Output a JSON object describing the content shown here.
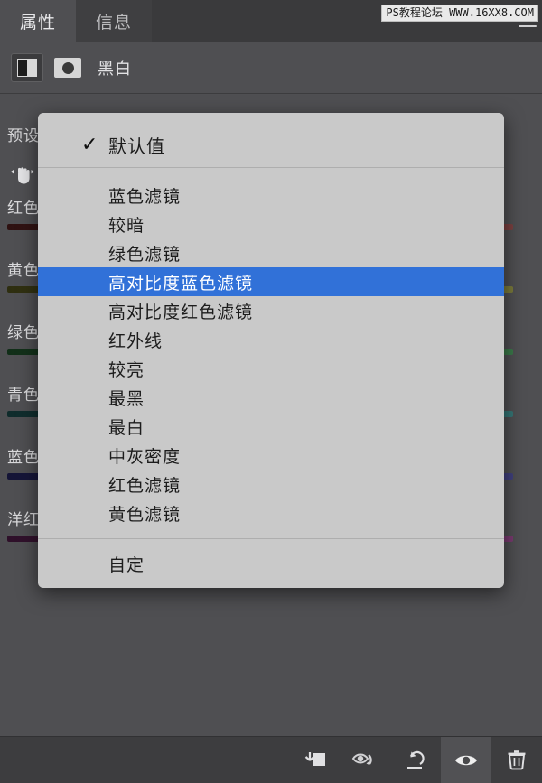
{
  "window": {
    "watermark": "PS教程论坛 WWW.16XX8.COM",
    "panel_menu_icon": "hamburger-menu-icon"
  },
  "tabs": [
    {
      "label": "属性",
      "active": true
    },
    {
      "label": "信息",
      "active": false
    }
  ],
  "adjustment": {
    "layer_icon": "black-and-white-adjustment-icon",
    "mask_icon": "layer-mask-thumbnail-icon",
    "title": "黑白"
  },
  "preset": {
    "label": "预设",
    "scrub_icon": "scrubby-hand-icon"
  },
  "channels": [
    {
      "label": "红色",
      "track_from": "#3b1a1a",
      "track_to": "#6d3b3b",
      "value_pos": 18
    },
    {
      "label": "黄色",
      "track_from": "#3a3a16",
      "track_to": "#6d6d33",
      "value_pos": 18
    },
    {
      "label": "绿色",
      "track_from": "#183a20",
      "track_to": "#356d41",
      "value_pos": 18
    },
    {
      "label": "青色",
      "track_from": "#163636",
      "track_to": "#2f6a6a",
      "value_pos": 18
    },
    {
      "label": "蓝色",
      "track_from": "#1c1c40",
      "track_to": "#3a3a72",
      "value_pos": 18
    },
    {
      "label": "洋红",
      "track_from": "#3a1736",
      "track_to": "#6d336a",
      "value_pos": 18
    }
  ],
  "dropdown": {
    "accent_color": "#3171d8",
    "background_color": "#c9c9c9",
    "header": {
      "label": "默认值",
      "checked": true,
      "check_glyph": "✓"
    },
    "items": [
      {
        "label": "蓝色滤镜",
        "selected": false
      },
      {
        "label": "较暗",
        "selected": false
      },
      {
        "label": "绿色滤镜",
        "selected": false
      },
      {
        "label": "高对比度蓝色滤镜",
        "selected": true
      },
      {
        "label": "高对比度红色滤镜",
        "selected": false
      },
      {
        "label": "红外线",
        "selected": false
      },
      {
        "label": "较亮",
        "selected": false
      },
      {
        "label": "最黑",
        "selected": false
      },
      {
        "label": "最白",
        "selected": false
      },
      {
        "label": "中灰密度",
        "selected": false
      },
      {
        "label": "红色滤镜",
        "selected": false
      },
      {
        "label": "黄色滤镜",
        "selected": false
      }
    ],
    "footer": {
      "label": "自定"
    }
  },
  "bottom_toolbar": {
    "buttons": [
      {
        "icon": "clip-to-layer-icon",
        "active": false
      },
      {
        "icon": "toggle-adjustment-view-icon",
        "active": false
      },
      {
        "icon": "reset-icon",
        "active": false
      },
      {
        "icon": "visibility-eye-icon",
        "active": true
      },
      {
        "icon": "delete-trash-icon",
        "active": false
      }
    ]
  }
}
